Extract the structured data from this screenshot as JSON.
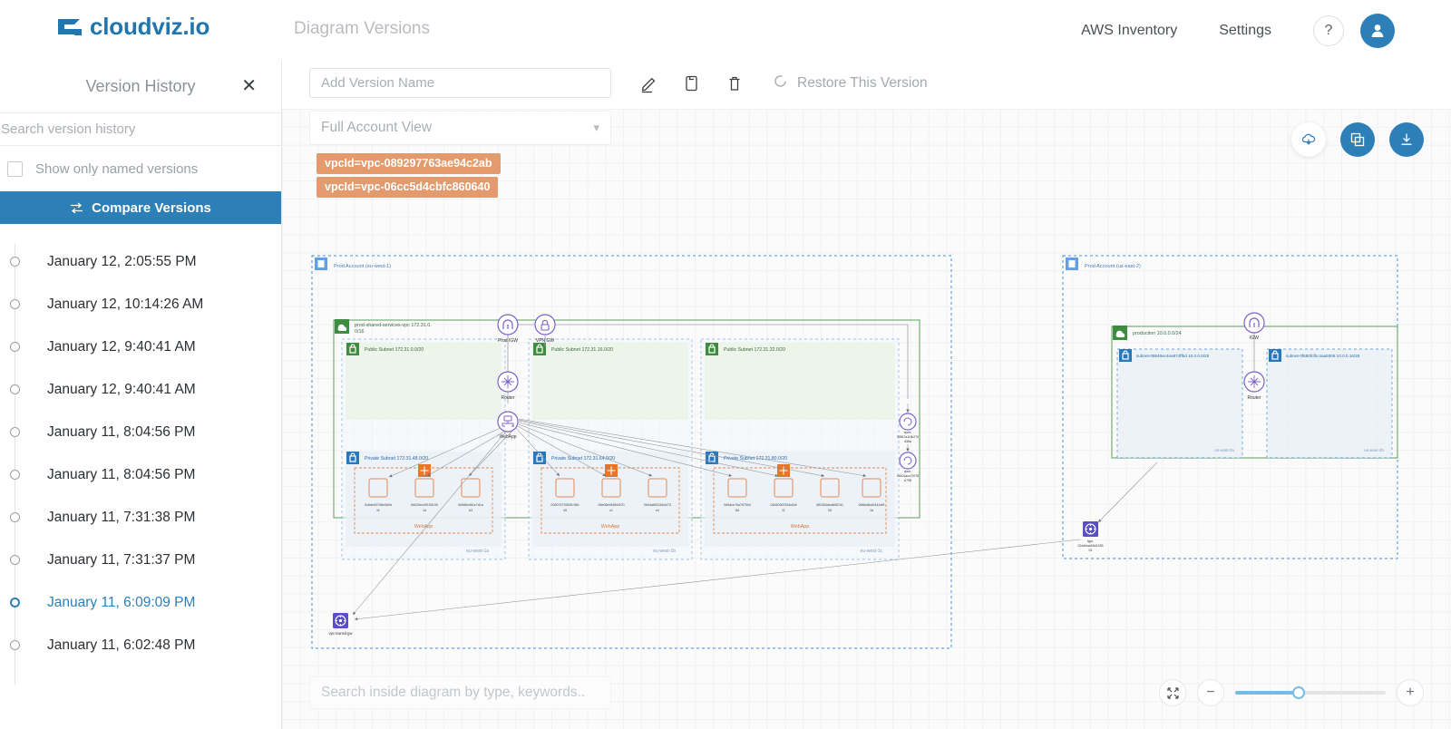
{
  "brand": {
    "name": "cloudviz.io",
    "logo_icon": "cloudviz-logo-icon",
    "accent": "#2176ae"
  },
  "header": {
    "title": "Diagram Versions",
    "nav": [
      {
        "label": "AWS Inventory",
        "name": "nav-aws-inventory"
      },
      {
        "label": "Settings",
        "name": "nav-settings"
      }
    ],
    "help_label": "?",
    "avatar_icon": "user-avatar-icon"
  },
  "sidebar": {
    "title": "Version History",
    "close_icon": "close-icon",
    "search": {
      "placeholder": "Search version history",
      "value": ""
    },
    "named_only": {
      "label": "Show only named versions",
      "checked": false
    },
    "compare_button": {
      "label": "Compare Versions",
      "icon": "compare-icon",
      "bg": "#2d7fb8"
    },
    "versions": [
      {
        "label": "January 12, 2:05:55 PM",
        "active": false
      },
      {
        "label": "January 12, 10:14:26 AM",
        "active": false
      },
      {
        "label": "January 12, 9:40:41 AM",
        "active": false
      },
      {
        "label": "January 12, 9:40:41 AM",
        "active": false
      },
      {
        "label": "January 11, 8:04:56 PM",
        "active": false
      },
      {
        "label": "January 11, 8:04:56 PM",
        "active": false
      },
      {
        "label": "January 11, 7:31:38 PM",
        "active": false
      },
      {
        "label": "January 11, 7:31:37 PM",
        "active": false
      },
      {
        "label": "January 11, 6:09:09 PM",
        "active": true
      },
      {
        "label": "January 11, 6:02:48 PM",
        "active": false
      }
    ]
  },
  "toolbar": {
    "version_name": {
      "placeholder": "Add Version Name",
      "value": ""
    },
    "edit_icon": "pencil-icon",
    "copy_icon": "copy-icon",
    "delete_icon": "trash-icon",
    "restore": {
      "label": "Restore This Version",
      "icon": "restore-circle-icon"
    }
  },
  "canvas": {
    "account_select": {
      "value": "Full Account View",
      "chevron": "chevron-down-icon"
    },
    "filter_tags": [
      "vpcId=vpc-089297763ae94c2ab",
      "vpcId=vpc-06cc5d4cbfc860640"
    ],
    "tag_color": "#e39b6e",
    "actions": [
      {
        "name": "cloud-download-button",
        "icon": "cloud-download-icon",
        "style": "white"
      },
      {
        "name": "duplicate-layers-button",
        "icon": "layers-copy-icon",
        "style": "blue"
      },
      {
        "name": "download-button",
        "icon": "download-icon",
        "style": "blue"
      }
    ],
    "search": {
      "placeholder": "Search inside diagram by type, keywords..",
      "value": ""
    },
    "zoom": {
      "fit_icon": "fit-screen-icon",
      "minus_label": "−",
      "plus_label": "+",
      "value_percent": 42
    }
  },
  "diagram": {
    "accounts": [
      {
        "label": "Prod Account (eu-west-1)",
        "icon": "account-flag-icon",
        "vpcs": [
          {
            "label": "prod-shared-services-vpc 172.31.0.0/16",
            "icon": "vpc-cloud-icon",
            "public_subnets": [
              {
                "label": "Public Subnet 172.31.0.0/20",
                "icon": "subnet-lock-icon"
              },
              {
                "label": "Public Subnet 172.31.16.0/20",
                "icon": "subnet-lock-icon"
              },
              {
                "label": "Public Subnet 172.31.32.0/20",
                "icon": "subnet-lock-icon"
              }
            ],
            "private_subnets": [
              {
                "label": "Private Subnet 172.31.48.0/20",
                "icon": "subnet-lock-icon",
                "az": "eu-west-1a",
                "group_label": "WebApp",
                "instances": [
                  "0c8de93708e3b9df4",
                  "06029ec091951901d",
                  "06988c961e7d1ab3"
                ]
              },
              {
                "label": "Private Subnet 172.31.64.0/20",
                "icon": "subnet-lock-icon",
                "az": "eu-west-1b",
                "group_label": "WebApp",
                "instances": [
                  "009075739535549",
                  "05e06b945fb0670c1",
                  "0644a8931b54473e4"
                ]
              },
              {
                "label": "Private Subnet 172.31.80.0/20",
                "icon": "subnet-lock-icon",
                "az": "eu-west-1c",
                "group_label": "WebApp",
                "instances": [
                  "0d9dce76a7679048d",
                  "02b50987524d2dff2",
                  "082454dea8957d105",
                  "068bc8bd0441df91b"
                ]
              }
            ]
          }
        ],
        "gateways": [
          {
            "label": "Prod IGW",
            "icon": "igw-icon"
          },
          {
            "label": "VPN GW",
            "icon": "vpn-gw-icon"
          },
          {
            "label": "Router",
            "icon": "router-icon"
          },
          {
            "label": "WebApp",
            "icon": "load-balancer-icon"
          }
        ],
        "endpoints": [
          {
            "label": "vpce-00847a11ffc270d36a",
            "icon": "vpc-endpoint-icon"
          },
          {
            "label": "vpce-0d401acc72078b798",
            "icon": "vpc-endpoint-icon"
          }
        ],
        "transit_gateway": {
          "label": "vpc-transit-gw",
          "icon": "transit-gateway-icon"
        }
      },
      {
        "label": "Prod Account (us-east-2)",
        "icon": "account-flag-icon",
        "vpcs": [
          {
            "label": "production 10.0.0.0/24",
            "icon": "vpc-cloud-icon",
            "subnets": [
              {
                "label": "subnet-09848ec4ea874ffbd 10.0.0.0/28",
                "az": "us-east-2a",
                "icon": "subnet-lock-icon"
              },
              {
                "label": "subnet-0f680fcfbc4aa9308 10.0.0.16/28",
                "az": "us-east-2b",
                "icon": "subnet-lock-icon"
              }
            ]
          }
        ],
        "gateways": [
          {
            "label": "IGW",
            "icon": "igw-icon"
          },
          {
            "label": "Router",
            "icon": "router-icon"
          }
        ],
        "transit_gateway": {
          "label": "tgw-02a44aa1ffd133501",
          "icon": "transit-gateway-icon"
        }
      }
    ]
  }
}
